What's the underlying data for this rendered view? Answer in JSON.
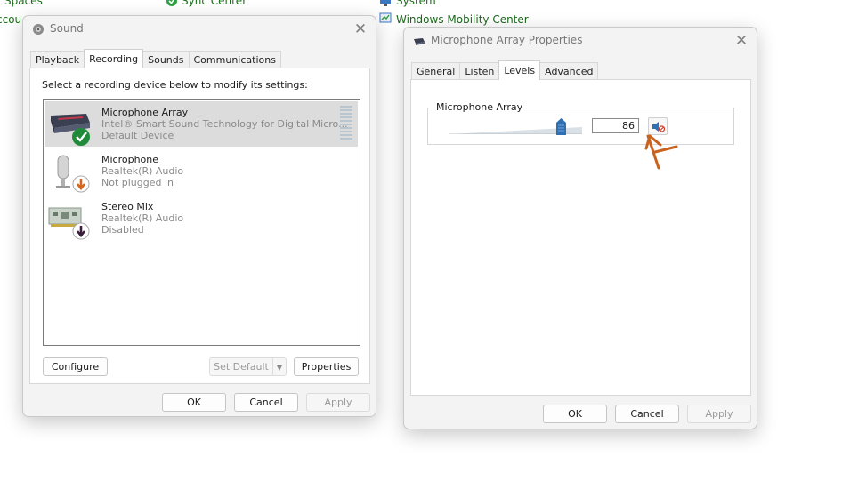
{
  "background": {
    "link1": "Spaces",
    "link2": "Sync Center",
    "link3": "System",
    "link4": "Windows Mobility Center",
    "link5": "ccou"
  },
  "sound_dialog": {
    "title": "Sound",
    "tabs": [
      {
        "label": "Playback",
        "active": false
      },
      {
        "label": "Recording",
        "active": true
      },
      {
        "label": "Sounds",
        "active": false
      },
      {
        "label": "Communications",
        "active": false
      }
    ],
    "instruction": "Select a recording device below to modify its settings:",
    "devices": [
      {
        "name": "Microphone Array",
        "description": "Intel® Smart Sound Technology for Digital Micro...",
        "status": "Default Device",
        "selected": true,
        "badge": "check-green"
      },
      {
        "name": "Microphone",
        "description": "Realtek(R) Audio",
        "status": "Not plugged in",
        "selected": false,
        "badge": "arrow-orange"
      },
      {
        "name": "Stereo Mix",
        "description": "Realtek(R) Audio",
        "status": "Disabled",
        "selected": false,
        "badge": "arrow-dark"
      }
    ],
    "configure_label": "Configure",
    "set_default_label": "Set Default",
    "properties_label": "Properties",
    "ok_label": "OK",
    "cancel_label": "Cancel",
    "apply_label": "Apply"
  },
  "properties_dialog": {
    "title": "Microphone Array Properties",
    "tabs": [
      {
        "label": "General",
        "active": false
      },
      {
        "label": "Listen",
        "active": false
      },
      {
        "label": "Levels",
        "active": true
      },
      {
        "label": "Advanced",
        "active": false
      }
    ],
    "group_label": "Microphone Array",
    "level_value": "86",
    "level_fraction": 0.86,
    "muted": true,
    "ok_label": "OK",
    "cancel_label": "Cancel",
    "apply_label": "Apply"
  },
  "colors": {
    "link_green": "#1c6a1c",
    "check_green": "#1e8a3a",
    "annotation_orange": "#c8621e",
    "slider_thumb": "#2f6fb4"
  },
  "icons": {
    "close": "close-icon",
    "sound_title": "speaker-icon",
    "props_title": "microphone-icon",
    "mute": "speaker-muted-icon"
  }
}
